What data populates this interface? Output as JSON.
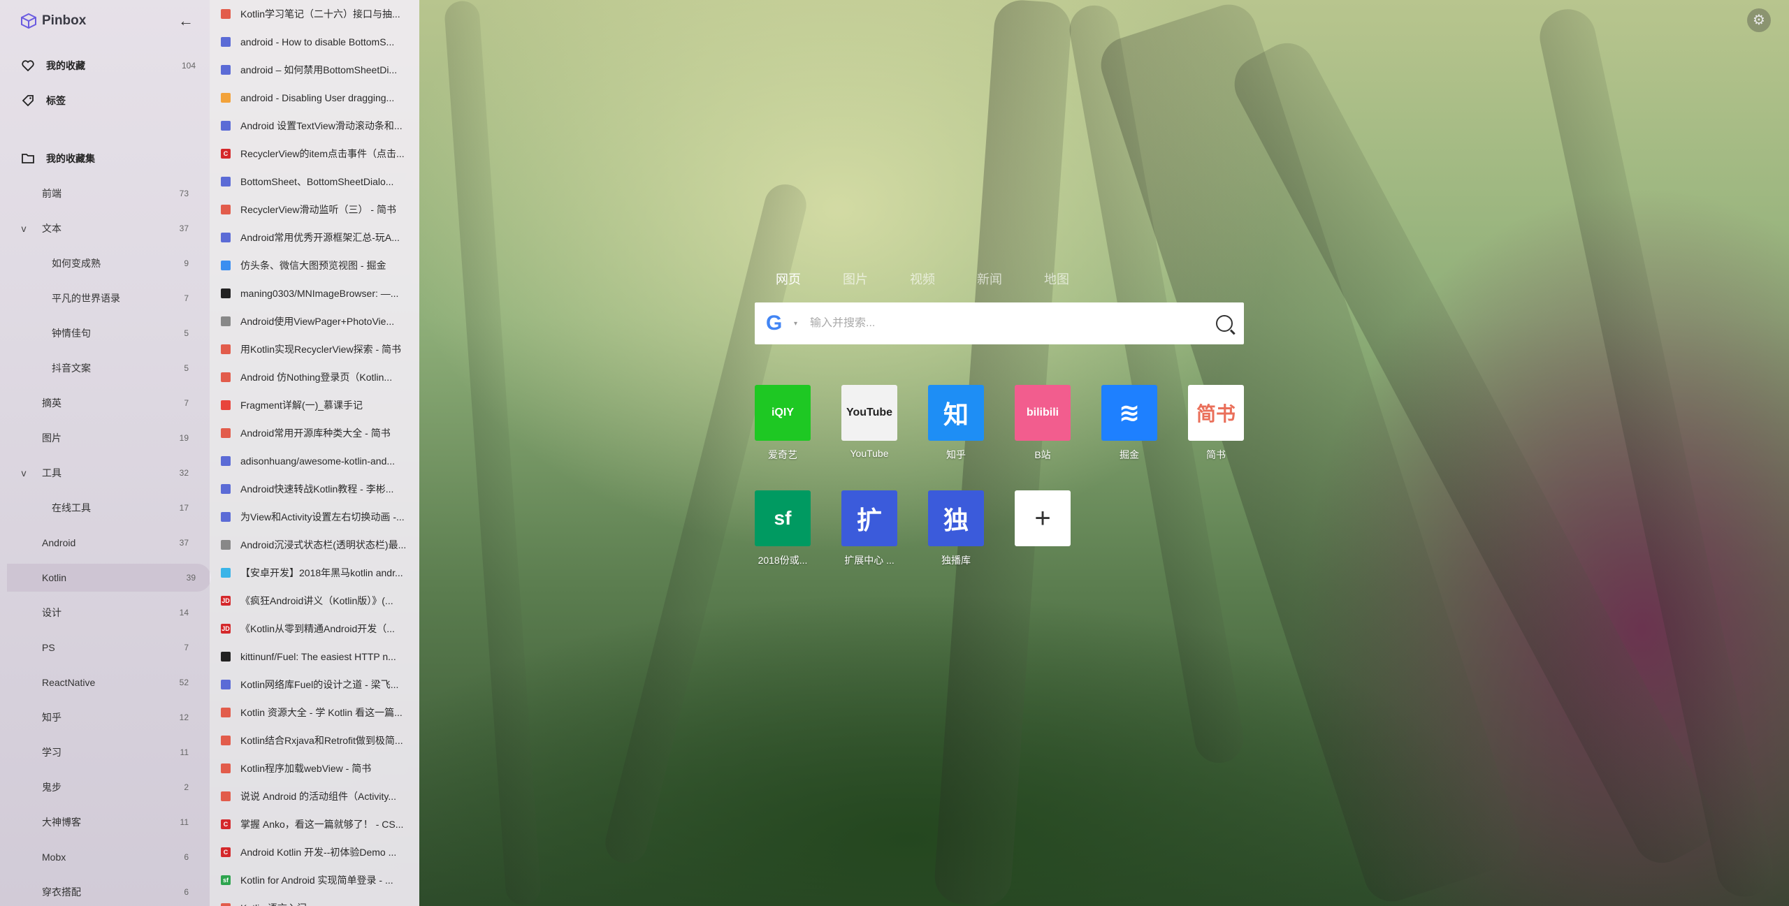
{
  "app": {
    "name": "Pinbox"
  },
  "sidebar": {
    "nav": [
      {
        "label": "我的收藏",
        "count": "104",
        "icon": "heart-icon"
      },
      {
        "label": "标签",
        "count": "",
        "icon": "tag-icon"
      },
      {
        "label": "我的收藏集",
        "count": "",
        "icon": "folder-icon"
      }
    ],
    "collections": [
      {
        "label": "前端",
        "count": "73",
        "level": 1,
        "expand": ""
      },
      {
        "label": "文本",
        "count": "37",
        "level": 1,
        "expand": "v"
      },
      {
        "label": "如何变成熟",
        "count": "9",
        "level": 2,
        "expand": ""
      },
      {
        "label": "平凡的世界语录",
        "count": "7",
        "level": 2,
        "expand": ""
      },
      {
        "label": "钟情佳句",
        "count": "5",
        "level": 2,
        "expand": ""
      },
      {
        "label": "抖音文案",
        "count": "5",
        "level": 2,
        "expand": ""
      },
      {
        "label": "摘英",
        "count": "7",
        "level": 1,
        "expand": ""
      },
      {
        "label": "图片",
        "count": "19",
        "level": 1,
        "expand": ""
      },
      {
        "label": "工具",
        "count": "32",
        "level": 1,
        "expand": "v"
      },
      {
        "label": "在线工具",
        "count": "17",
        "level": 2,
        "expand": ""
      },
      {
        "label": "Android",
        "count": "37",
        "level": 1,
        "expand": ""
      },
      {
        "label": "Kotlin",
        "count": "39",
        "level": 1,
        "expand": "",
        "active": true
      },
      {
        "label": "设计",
        "count": "14",
        "level": 1,
        "expand": ""
      },
      {
        "label": "PS",
        "count": "7",
        "level": 1,
        "expand": ""
      },
      {
        "label": "ReactNative",
        "count": "52",
        "level": 1,
        "expand": ""
      },
      {
        "label": "知乎",
        "count": "12",
        "level": 1,
        "expand": ""
      },
      {
        "label": "学习",
        "count": "11",
        "level": 1,
        "expand": ""
      },
      {
        "label": "鬼步",
        "count": "2",
        "level": 1,
        "expand": ""
      },
      {
        "label": "大神博客",
        "count": "11",
        "level": 1,
        "expand": ""
      },
      {
        "label": "Mobx",
        "count": "6",
        "level": 1,
        "expand": ""
      },
      {
        "label": "穿衣搭配",
        "count": "6",
        "level": 1,
        "expand": ""
      }
    ]
  },
  "bookmarks": [
    {
      "title": "Kotlin学习笔记（二十六）接口与抽...",
      "color": "#e25c4b",
      "glyph": ""
    },
    {
      "title": "android - How to disable BottomS...",
      "color": "#5b6bd6",
      "glyph": ""
    },
    {
      "title": "android – 如何禁用BottomSheetDi...",
      "color": "#5b6bd6",
      "glyph": ""
    },
    {
      "title": "android - Disabling User dragging...",
      "color": "#f2a23a",
      "glyph": ""
    },
    {
      "title": "Android 设置TextView滑动滚动条和...",
      "color": "#5b6bd6",
      "glyph": ""
    },
    {
      "title": "RecyclerView的item点击事件（点击...",
      "color": "#d4282b",
      "glyph": "C"
    },
    {
      "title": "BottomSheet、BottomSheetDialo...",
      "color": "#5b6bd6",
      "glyph": ""
    },
    {
      "title": "RecyclerView滑动监听（三） - 简书",
      "color": "#e25c4b",
      "glyph": ""
    },
    {
      "title": "Android常用优秀开源框架汇总-玩A...",
      "color": "#5b6bd6",
      "glyph": ""
    },
    {
      "title": "仿头条、微信大图预览视图 - 掘金",
      "color": "#3b8ef0",
      "glyph": ""
    },
    {
      "title": "maning0303/MNImageBrowser: —...",
      "color": "#222222",
      "glyph": ""
    },
    {
      "title": "Android使用ViewPager+PhotoVie...",
      "color": "#888888",
      "glyph": ""
    },
    {
      "title": "用Kotlin实现RecyclerView探索 - 简书",
      "color": "#e25c4b",
      "glyph": ""
    },
    {
      "title": "Android 仿Nothing登录页（Kotlin...",
      "color": "#e25c4b",
      "glyph": ""
    },
    {
      "title": "Fragment详解(一)_慕课手记",
      "color": "#e8453c",
      "glyph": ""
    },
    {
      "title": "Android常用开源库种类大全 - 简书",
      "color": "#e25c4b",
      "glyph": ""
    },
    {
      "title": "adisonhuang/awesome-kotlin-and...",
      "color": "#5b6bd6",
      "glyph": ""
    },
    {
      "title": "Android快速转战Kotlin教程 - 李彬...",
      "color": "#5b6bd6",
      "glyph": ""
    },
    {
      "title": "为View和Activity设置左右切换动画 -...",
      "color": "#5b6bd6",
      "glyph": ""
    },
    {
      "title": "Android沉浸式状态栏(透明状态栏)最...",
      "color": "#888888",
      "glyph": ""
    },
    {
      "title": "【安卓开发】2018年黑马kotlin andr...",
      "color": "#3ab4e8",
      "glyph": ""
    },
    {
      "title": "《疯狂Android讲义（Kotlin版）》(...",
      "color": "#d4282b",
      "glyph": "JD"
    },
    {
      "title": "《Kotlin从零到精通Android开发（...",
      "color": "#d4282b",
      "glyph": "JD"
    },
    {
      "title": "kittinunf/Fuel: The easiest HTTP n...",
      "color": "#222222",
      "glyph": ""
    },
    {
      "title": "Kotlin网络库Fuel的设计之道 - 梁飞...",
      "color": "#5b6bd6",
      "glyph": ""
    },
    {
      "title": "Kotlin 资源大全 - 学 Kotlin 看这一篇...",
      "color": "#e25c4b",
      "glyph": ""
    },
    {
      "title": "Kotlin结合Rxjava和Retrofit做到极简...",
      "color": "#e25c4b",
      "glyph": ""
    },
    {
      "title": "Kotlin程序加载webView - 简书",
      "color": "#e25c4b",
      "glyph": ""
    },
    {
      "title": "说说 Android 的活动组件（Activity...",
      "color": "#e25c4b",
      "glyph": ""
    },
    {
      "title": "掌握 Anko，看这一篇就够了！ - CS...",
      "color": "#d4282b",
      "glyph": "C"
    },
    {
      "title": "Android Kotlin 开发--初体验Demo ...",
      "color": "#d4282b",
      "glyph": "C"
    },
    {
      "title": "Kotlin for Android 实现简单登录 - ...",
      "color": "#2da44e",
      "glyph": "sf"
    },
    {
      "title": "Kotlin 语言入门",
      "color": "#e25c4b",
      "glyph": ""
    }
  ],
  "search": {
    "tabs": [
      "网页",
      "图片",
      "视频",
      "新闻",
      "地图"
    ],
    "active_tab": 0,
    "engine_letter": "G",
    "caret": "▾",
    "placeholder": "输入并搜索..."
  },
  "tiles": [
    {
      "label": "爱奇艺",
      "glyph": "iQIY",
      "bg": "#1ec823",
      "fg": "#ffffff",
      "icon": "iqiyi-icon"
    },
    {
      "label": "YouTube",
      "glyph": "YouTube",
      "bg": "#f2f2f2",
      "fg": "#222222",
      "icon": "youtube-icon"
    },
    {
      "label": "知乎",
      "glyph": "知",
      "bg": "#1e8ef5",
      "fg": "#ffffff",
      "icon": "zhihu-icon"
    },
    {
      "label": "B站",
      "glyph": "bilibili",
      "bg": "#f25d8e",
      "fg": "#ffffff",
      "icon": "bilibili-icon"
    },
    {
      "label": "掘金",
      "glyph": "≋",
      "bg": "#1e80ff",
      "fg": "#ffffff",
      "icon": "juejin-icon"
    },
    {
      "label": "简书",
      "glyph": "简书",
      "bg": "#ffffff",
      "fg": "#ea6f5a",
      "icon": "jianshu-icon"
    },
    {
      "label": "2018份或...",
      "glyph": "sf",
      "bg": "#009a61",
      "fg": "#ffffff",
      "icon": "segmentfault-icon"
    },
    {
      "label": "扩展中心 ...",
      "glyph": "扩",
      "bg": "#3b5bdb",
      "fg": "#ffffff",
      "icon": "extension-icon"
    },
    {
      "label": "独播库",
      "glyph": "独",
      "bg": "#3b5bdb",
      "fg": "#ffffff",
      "icon": "dubo-icon"
    },
    {
      "label": "",
      "glyph": "+",
      "bg": "#ffffff",
      "fg": "#333333",
      "icon": "add-icon"
    }
  ],
  "colors": {
    "accent": "#5b6bd6",
    "sidebar_active": "#cdc4d2"
  }
}
